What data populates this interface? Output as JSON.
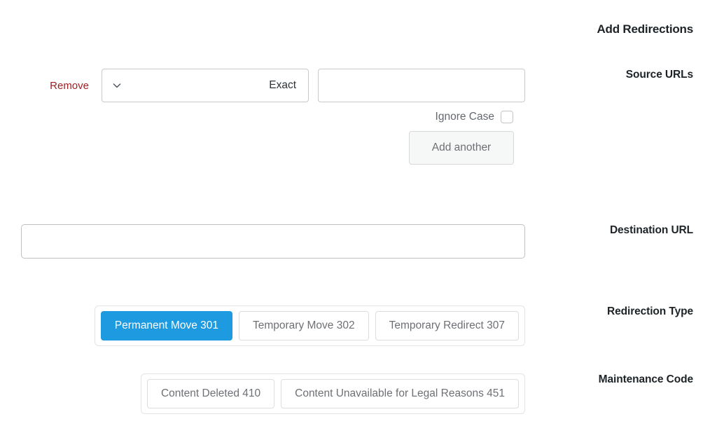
{
  "header": {
    "title": "Add Redirections"
  },
  "labels": {
    "source_urls": "Source URLs",
    "destination_url": "Destination URL",
    "redirection_type": "Redirection Type",
    "maintenance_code": "Maintenance Code"
  },
  "source_urls": {
    "remove_label": "Remove",
    "match_type": {
      "selected": "Exact",
      "icon": "chevron-down-icon"
    },
    "url_input": {
      "value": "",
      "placeholder": ""
    },
    "ignore_case": {
      "label": "Ignore Case",
      "checked": false
    },
    "add_another_label": "Add another"
  },
  "destination_url": {
    "value": "",
    "placeholder": ""
  },
  "redirection_type": {
    "options": [
      {
        "label": "Permanent Move 301",
        "active": true
      },
      {
        "label": "Temporary Move 302",
        "active": false
      },
      {
        "label": "Temporary Redirect 307",
        "active": false
      }
    ]
  },
  "maintenance_code": {
    "options": [
      {
        "label": "Content Deleted 410",
        "active": false
      },
      {
        "label": "Content Unavailable for Legal Reasons 451",
        "active": false
      }
    ]
  },
  "colors": {
    "accent_blue": "#1e9ae0",
    "remove_red": "#a02022",
    "label_text": "#1d2327",
    "muted_text": "#6d7075",
    "border": "#c9c9cd"
  }
}
